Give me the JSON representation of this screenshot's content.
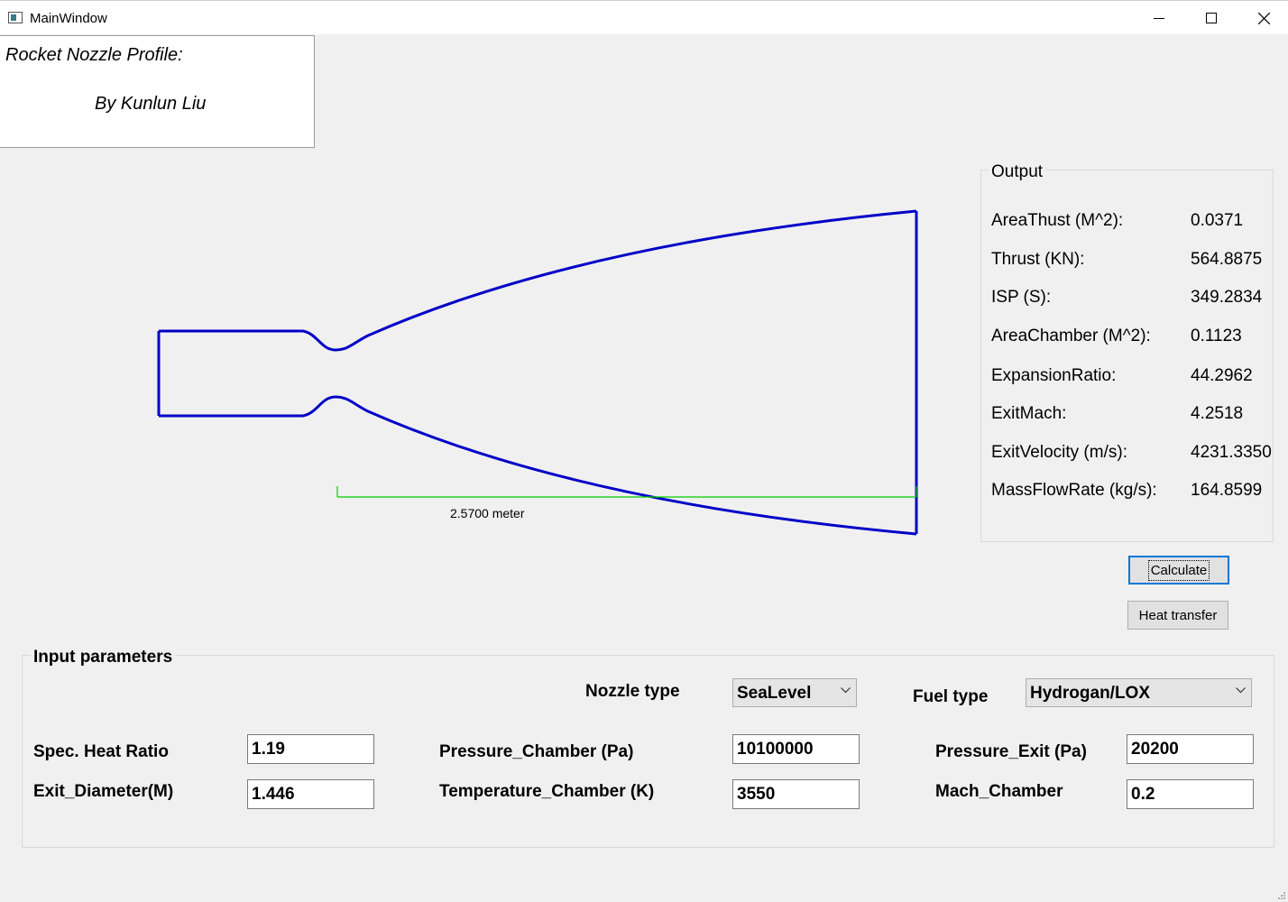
{
  "window": {
    "title": "MainWindow"
  },
  "header": {
    "title": "Rocket Nozzle Profile:",
    "author": "By Kunlun Liu"
  },
  "nozzle_plot": {
    "line_color": "#0000c8",
    "scale_color": "#00d000",
    "scale_label": "2.5700 meter"
  },
  "output": {
    "legend": "Output",
    "rows": [
      {
        "label": "AreaThust (M^2):",
        "value": "0.0371"
      },
      {
        "label": "Thrust (KN):",
        "value": "564.8875"
      },
      {
        "label": "ISP (S):",
        "value": "349.2834"
      },
      {
        "label": "AreaChamber (M^2):",
        "value": "0.1123"
      },
      {
        "label": "ExpansionRatio:",
        "value": "44.2962"
      },
      {
        "label": "ExitMach:",
        "value": "4.2518"
      },
      {
        "label": "ExitVelocity (m/s):",
        "value": "4231.3350"
      },
      {
        "label": "MassFlowRate (kg/s):",
        "value": "164.8599"
      }
    ]
  },
  "buttons": {
    "calculate": "Calculate",
    "heat_transfer": "Heat transfer"
  },
  "inputs": {
    "legend": "Input parameters",
    "nozzle_type": {
      "label": "Nozzle type",
      "value": "SeaLevel"
    },
    "fuel_type": {
      "label": "Fuel type",
      "value": "Hydrogan/LOX"
    },
    "spec_heat_ratio": {
      "label": "Spec. Heat Ratio",
      "value": "1.19"
    },
    "exit_diameter": {
      "label": "Exit_Diameter(M)",
      "value": "1.446"
    },
    "pressure_chamber": {
      "label": "Pressure_Chamber (Pa)",
      "value": "10100000"
    },
    "temperature_chamber": {
      "label": "Temperature_Chamber (K)",
      "value": "3550"
    },
    "pressure_exit": {
      "label": "Pressure_Exit (Pa)",
      "value": "20200"
    },
    "mach_chamber": {
      "label": "Mach_Chamber",
      "value": "0.2"
    }
  }
}
